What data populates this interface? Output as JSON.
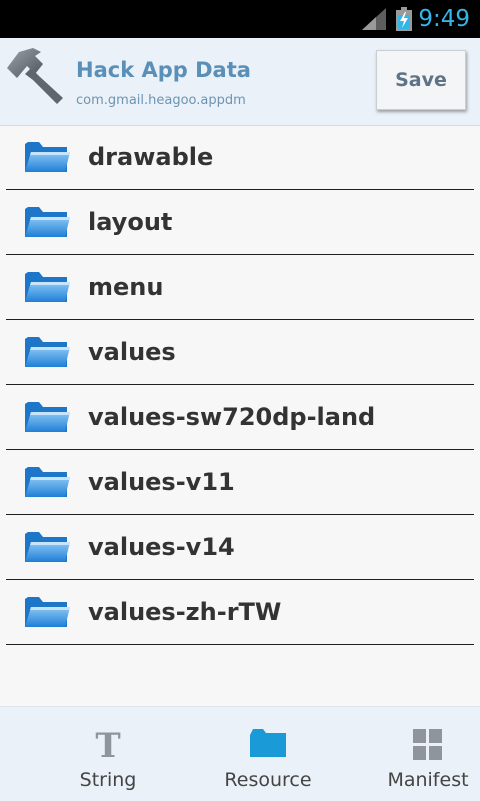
{
  "status_bar": {
    "time": "9:49",
    "time_color": "#33b5e5",
    "icons": [
      "signal-icon",
      "battery-charging-icon"
    ]
  },
  "header": {
    "title": "Hack App Data",
    "subtitle": "com.gmail.heagoo.appdm",
    "save_label": "Save",
    "app_icon": "hammer-icon",
    "title_color": "#5a8fb8"
  },
  "folders": [
    {
      "name": "drawable",
      "icon": "folder-icon"
    },
    {
      "name": "layout",
      "icon": "folder-icon"
    },
    {
      "name": "menu",
      "icon": "folder-icon"
    },
    {
      "name": "values",
      "icon": "folder-icon"
    },
    {
      "name": "values-sw720dp-land",
      "icon": "folder-icon"
    },
    {
      "name": "values-v11",
      "icon": "folder-icon"
    },
    {
      "name": "values-v14",
      "icon": "folder-icon"
    },
    {
      "name": "values-zh-rTW",
      "icon": "folder-icon"
    }
  ],
  "tabs": [
    {
      "label": "String",
      "icon": "text-t-icon"
    },
    {
      "label": "Resource",
      "icon": "folder-icon",
      "selected": true
    },
    {
      "label": "Manifest",
      "icon": "grid-icon"
    }
  ],
  "colors": {
    "accent": "#33b5e5",
    "header_bg": "#eaf1f8",
    "folder_blue": "#2f8fe0"
  }
}
